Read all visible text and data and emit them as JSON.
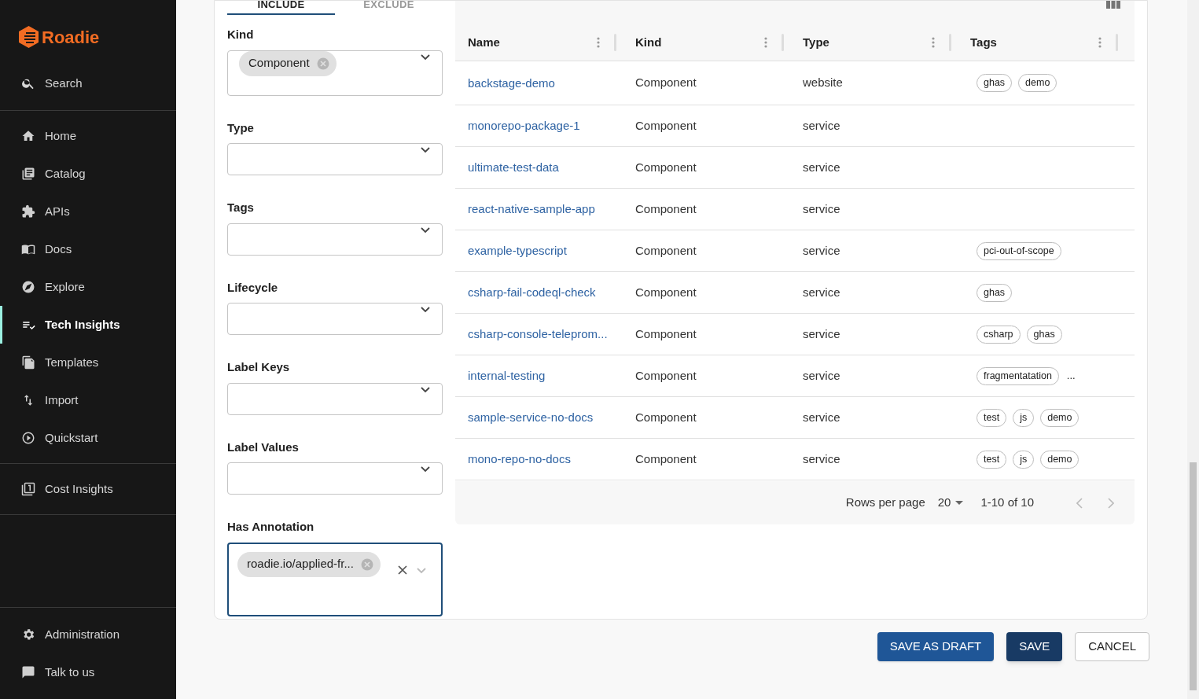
{
  "sidebar": {
    "logo": "Roadie",
    "search": "Search",
    "groups": [
      [
        {
          "label": "Home",
          "selected": false
        },
        {
          "label": "Catalog",
          "selected": false
        },
        {
          "label": "APIs",
          "selected": false
        },
        {
          "label": "Docs",
          "selected": false
        },
        {
          "label": "Explore",
          "selected": false
        },
        {
          "label": "Tech Insights",
          "selected": true
        },
        {
          "label": "Templates",
          "selected": false
        },
        {
          "label": "Import",
          "selected": false
        },
        {
          "label": "Quickstart",
          "selected": false
        }
      ],
      [
        {
          "label": "Cost Insights",
          "selected": false
        }
      ]
    ],
    "bottom": [
      {
        "label": "Administration",
        "selected": false
      },
      {
        "label": "Talk to us",
        "selected": false
      }
    ]
  },
  "tabs": [
    {
      "label": "INCLUDE",
      "selected": true
    },
    {
      "label": "EXCLUDE",
      "selected": false
    }
  ],
  "filters": [
    {
      "label": "Kind",
      "chips": [
        "Component"
      ],
      "focused": false,
      "clearable": false
    },
    {
      "label": "Type",
      "focused": false,
      "clearable": false
    },
    {
      "label": "Tags",
      "focused": false,
      "clearable": false
    },
    {
      "label": "Lifecycle",
      "focused": false,
      "clearable": false
    },
    {
      "label": "Label Keys",
      "focused": false,
      "clearable": false
    },
    {
      "label": "Label Values",
      "focused": false,
      "clearable": false
    },
    {
      "label": "Has Annotation",
      "chips": [
        "roadie.io/applied-fr..."
      ],
      "focused": true,
      "clearable": true
    }
  ],
  "table": {
    "columns": [
      "Name",
      "Kind",
      "Type",
      "Tags"
    ],
    "rows": [
      {
        "name": "backstage-demo",
        "kind": "Component",
        "type": "website",
        "tags": [
          "ghas",
          "demo"
        ]
      },
      {
        "name": "monorepo-package-1",
        "kind": "Component",
        "type": "service"
      },
      {
        "name": "ultimate-test-data",
        "kind": "Component",
        "type": "service"
      },
      {
        "name": "react-native-sample-app",
        "kind": "Component",
        "type": "service"
      },
      {
        "name": "example-typescript",
        "kind": "Component",
        "type": "service",
        "tags": [
          "pci-out-of-scope"
        ]
      },
      {
        "name": "csharp-fail-codeql-check",
        "kind": "Component",
        "type": "service",
        "tags": [
          "ghas"
        ]
      },
      {
        "name": "csharp-console-teleprom...",
        "kind": "Component",
        "type": "service",
        "tags": [
          "csharp",
          "ghas"
        ]
      },
      {
        "name": "internal-testing",
        "kind": "Component",
        "type": "service",
        "tags": [
          "fragmentatation"
        ],
        "more": "..."
      },
      {
        "name": "sample-service-no-docs",
        "kind": "Component",
        "type": "service",
        "tags": [
          "test",
          "js",
          "demo"
        ]
      },
      {
        "name": "mono-repo-no-docs",
        "kind": "Component",
        "type": "service",
        "tags": [
          "test",
          "js",
          "demo"
        ]
      }
    ],
    "pagination": {
      "rows_per_page_label": "Rows per page",
      "rows_per_page": "20",
      "range": "1-10 of 10"
    }
  },
  "buttons": [
    {
      "label": "SAVE AS DRAFT",
      "kind": "primary"
    },
    {
      "label": "SAVE",
      "kind": "dark"
    },
    {
      "label": "CANCEL",
      "kind": "outlined"
    }
  ]
}
